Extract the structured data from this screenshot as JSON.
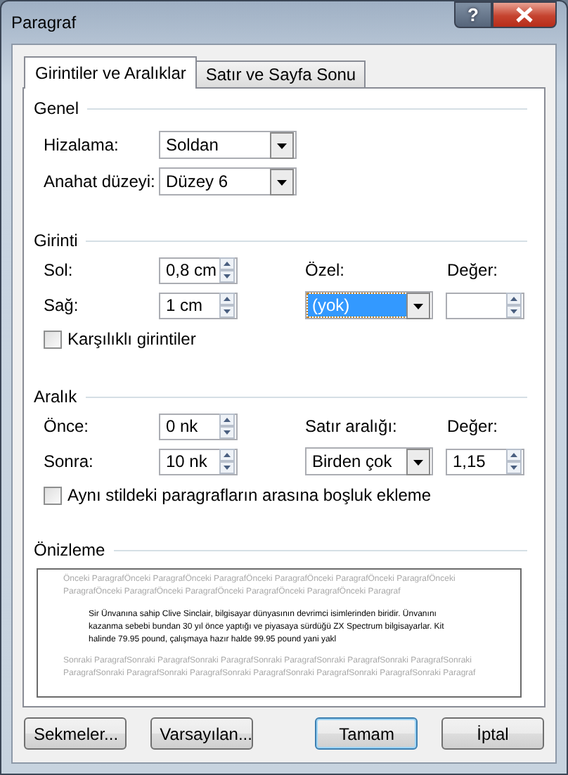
{
  "window": {
    "title": "Paragraf",
    "help": "?"
  },
  "tabs": [
    {
      "label": "Girintiler ve Aralıklar",
      "selected": true
    },
    {
      "label": "Satır ve Sayfa Sonu",
      "selected": false
    }
  ],
  "genel": {
    "title": "Genel",
    "alignment": {
      "label": "Hizalama:",
      "value": "Soldan"
    },
    "outline_level": {
      "label": "Anahat düzeyi:",
      "value": "Düzey 6"
    }
  },
  "girinti": {
    "title": "Girinti",
    "left": {
      "label": "Sol:",
      "value": "0,8 cm"
    },
    "right": {
      "label": "Sağ:",
      "value": "1 cm"
    },
    "special": {
      "label": "Özel:",
      "value": "(yok)",
      "focused": true
    },
    "by": {
      "label": "Değer:"
    },
    "mirror": {
      "label": "Karşılıklı girintiler",
      "checked": false
    }
  },
  "aralik": {
    "title": "Aralık",
    "before": {
      "label": "Önce:",
      "value": "0 nk"
    },
    "after": {
      "label": "Sonra:",
      "value": "10 nk"
    },
    "line_spacing": {
      "label": "Satır aralığı:",
      "value": "Birden çok",
      "focused": false
    },
    "at": {
      "label": "Değer:",
      "value": "1,15"
    },
    "dont_add_space": {
      "label": "Aynı stildeki paragrafların arasına boşluk ekleme",
      "checked": false
    }
  },
  "preview": {
    "title": "Önizleme",
    "previous_text": "Önceki ParagrafÖnceki ParagrafÖnceki ParagrafÖnceki ParagrafÖnceki ParagrafÖnceki ParagrafÖnceki ParagrafÖnceki ParagrafÖnceki ParagrafÖnceki ParagrafÖnceki ParagrafÖnceki Paragraf",
    "sample_text": "Sir Ünvanına sahip Clive Sinclair, bilgisayar dünyasının devrimci isimlerinden biridir. Ünvanını kazanma sebebi bundan 30 yıl önce yaptığı ve piyasaya sürdüğü ZX Spectrum bilgisayarlar. Kit halinde 79.95 pound, çalışmaya hazır halde 99.95 pound yani yakl",
    "next_text": "Sonraki ParagrafSonraki ParagrafSonraki ParagrafSonraki ParagrafSonraki ParagrafSonraki ParagrafSonraki ParagrafSonraki ParagrafSonraki ParagrafSonraki ParagrafSonraki ParagrafSonraki ParagrafSonraki Paragraf"
  },
  "buttons": [
    {
      "label": "Sekmeler...",
      "default": false
    },
    {
      "label": "Varsayılan...",
      "default": false
    },
    {
      "label": "Tamam",
      "default": true
    },
    {
      "label": "İptal",
      "default": false
    }
  ]
}
